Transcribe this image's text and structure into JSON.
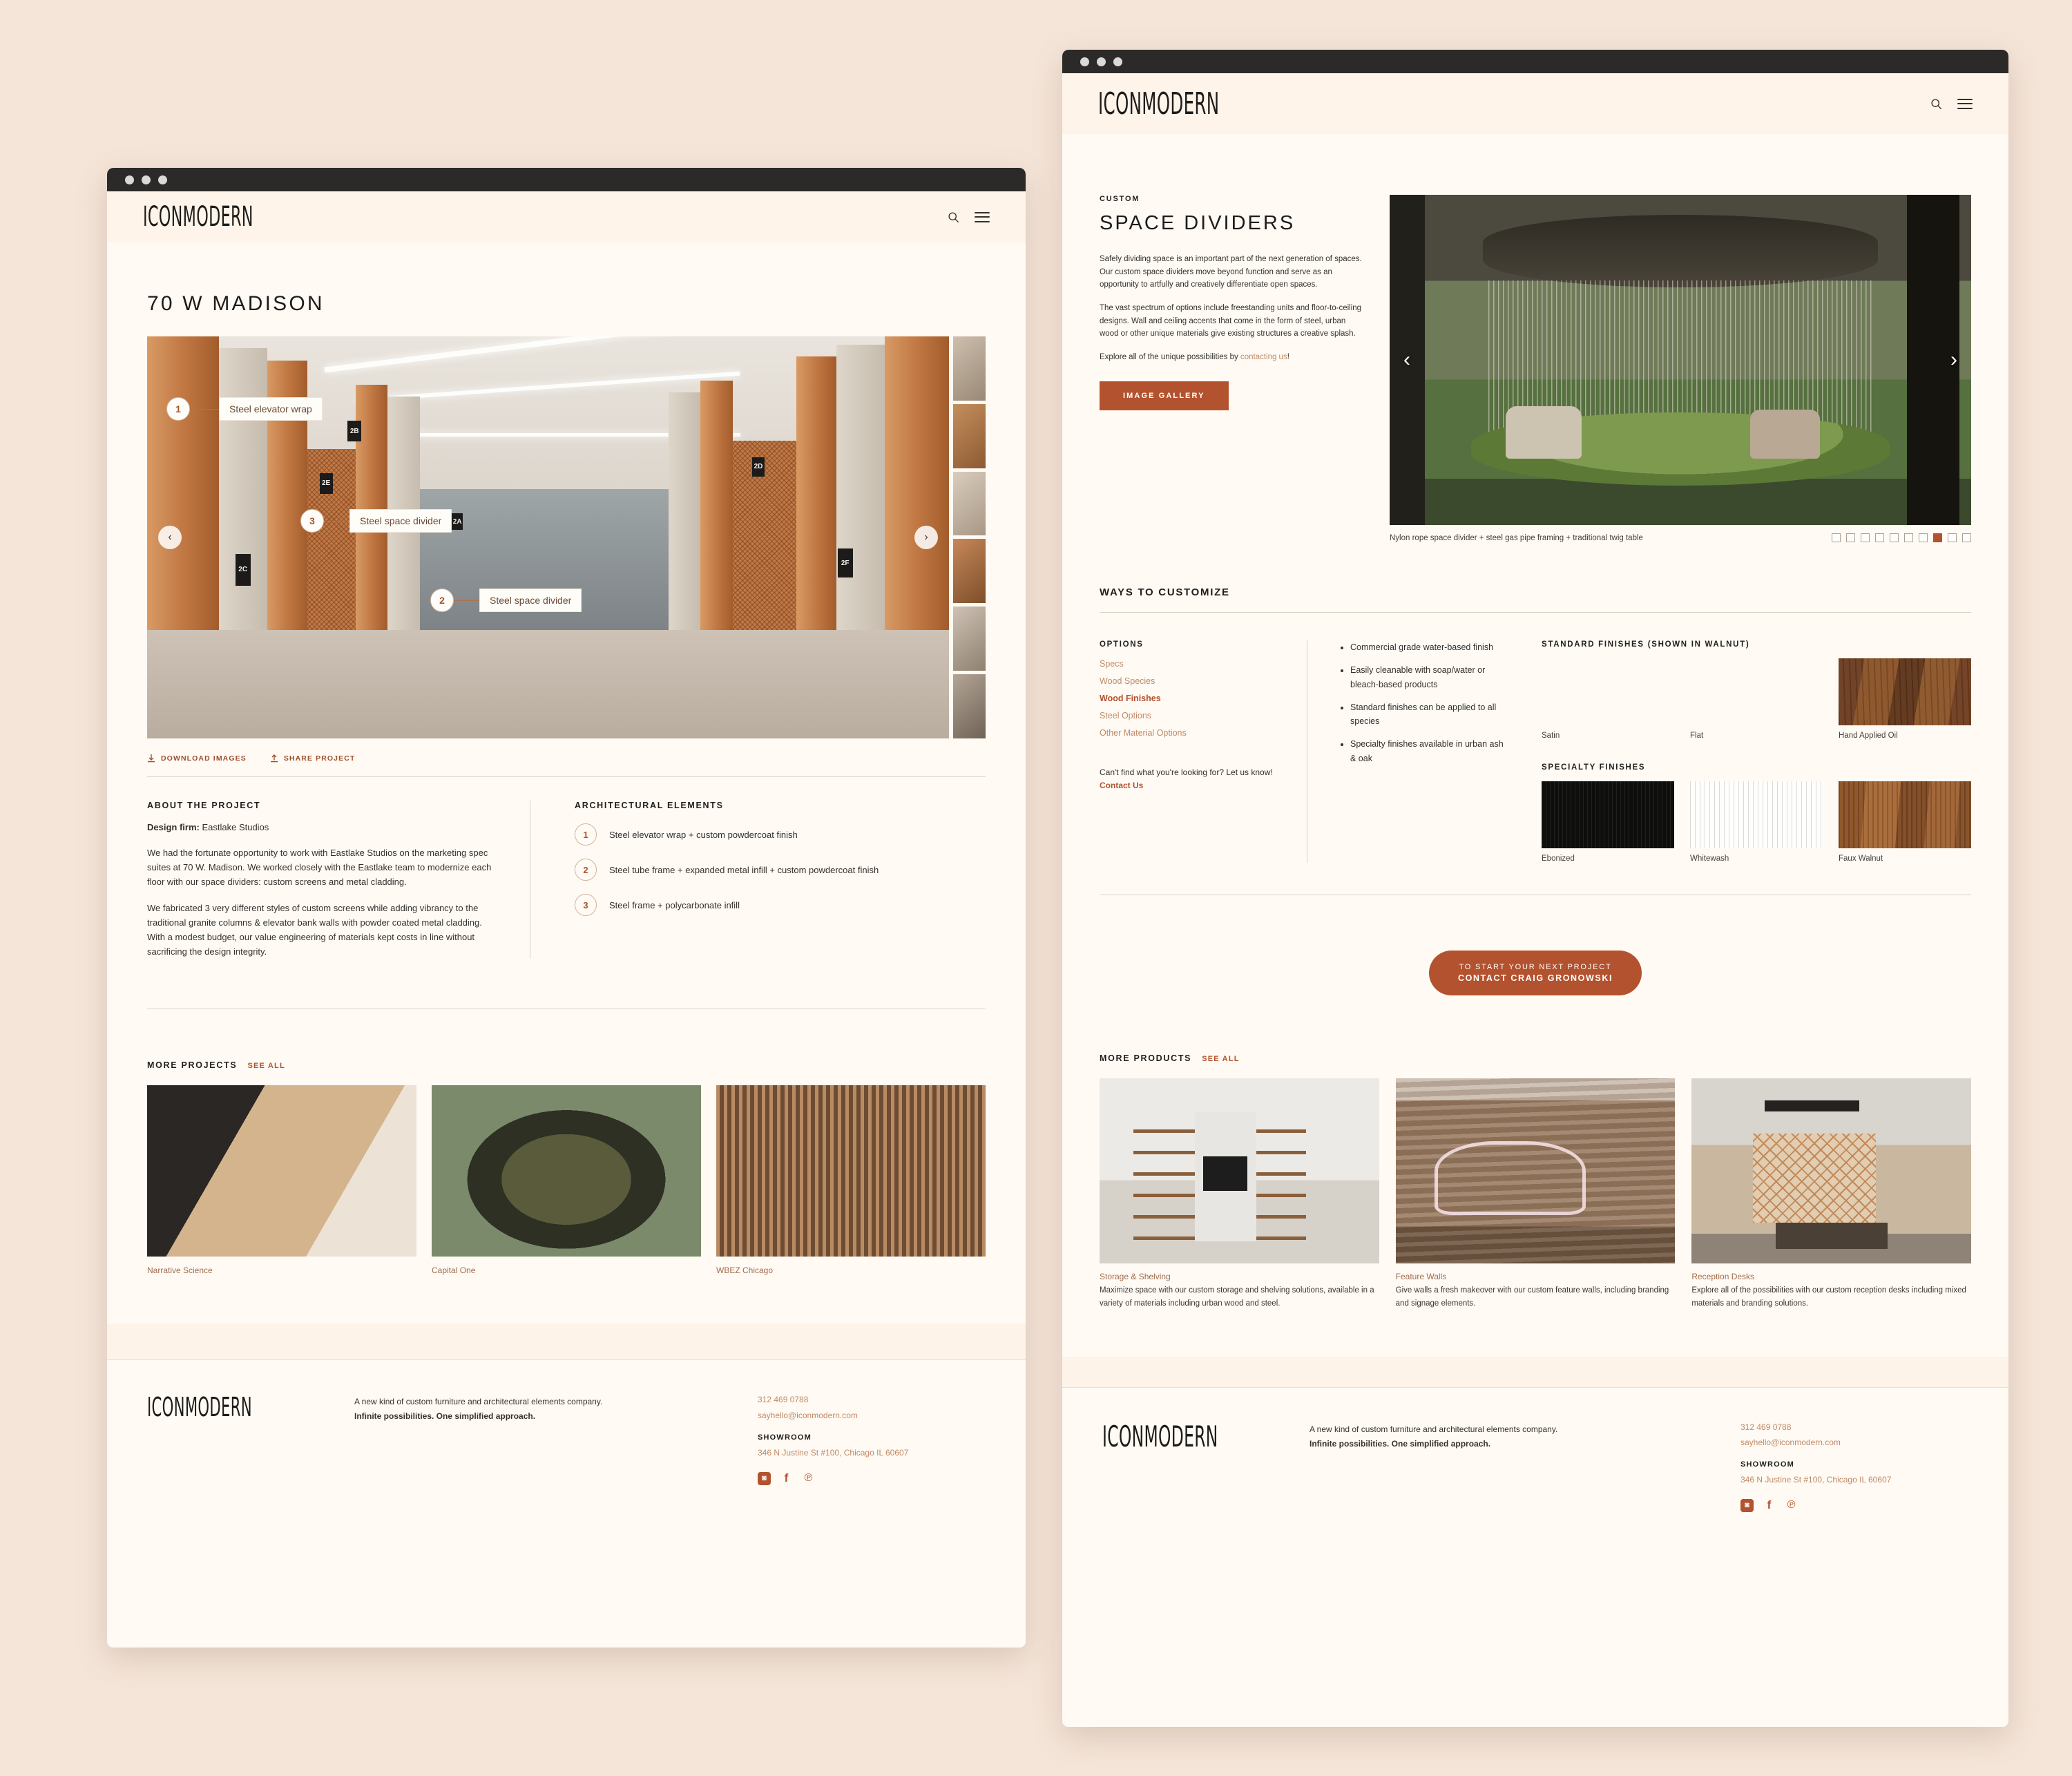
{
  "brand": {
    "logo": "ICONMODERN"
  },
  "header": {
    "search_icon": "search-icon",
    "menu_icon": "hamburger-menu-icon"
  },
  "project_page": {
    "title": "70 W MADISON",
    "hero_callouts": [
      {
        "num": "1",
        "label": "Steel elevator wrap"
      },
      {
        "num": "3",
        "label": "Steel space divider"
      },
      {
        "num": "2",
        "label": "Steel space divider"
      }
    ],
    "hero_prev": "‹",
    "hero_next": "›",
    "meta_links": [
      {
        "label": "DOWNLOAD IMAGES",
        "icon": "download-icon"
      },
      {
        "label": "SHARE PROJECT",
        "icon": "share-icon"
      }
    ],
    "about": {
      "heading": "ABOUT THE PROJECT",
      "design_firm_label": "Design firm:",
      "design_firm": "Eastlake Studios",
      "paragraph1": "We had the fortunate opportunity to work with Eastlake Studios on the marketing spec suites at 70 W. Madison. We worked closely with the Eastlake team to modernize each floor with our space dividers: custom screens and metal cladding.",
      "paragraph2": "We fabricated 3 very different styles of custom screens while adding vibrancy to the traditional granite columns & elevator bank walls with powder coated metal cladding. With a modest budget, our value engineering of materials kept costs in line without sacrificing the design integrity."
    },
    "elements": {
      "heading": "ARCHITECTURAL ELEMENTS",
      "items": [
        {
          "num": "1",
          "text": "Steel elevator wrap + custom powdercoat finish"
        },
        {
          "num": "2",
          "text": "Steel tube frame + expanded metal infill + custom powdercoat finish"
        },
        {
          "num": "3",
          "text": "Steel frame + polycarbonate infill"
        }
      ]
    },
    "more_projects": {
      "heading": "MORE PROJECTS",
      "see_all": "SEE ALL",
      "items": [
        {
          "caption": "Narrative Science"
        },
        {
          "caption": "Capital One"
        },
        {
          "caption": "WBEZ Chicago"
        }
      ]
    }
  },
  "product_page": {
    "eyebrow": "CUSTOM",
    "title": "SPACE DIVIDERS",
    "paragraph1": "Safely dividing space is an important part of the next generation of spaces. Our custom space dividers move beyond function and serve as an opportunity to artfully and creatively differentiate open spaces.",
    "paragraph2": "The vast spectrum of options include freestanding units and floor-to-ceiling designs. Wall and ceiling accents that come in the form of steel, urban wood or other unique materials give existing structures a creative splash.",
    "paragraph3_pre": "Explore all of the unique possibilities by ",
    "paragraph3_link": "contacting us",
    "paragraph3_post": "!",
    "gallery_button": "IMAGE GALLERY",
    "carousel": {
      "prev": "‹",
      "next": "›",
      "caption": "Nylon rope space divider + steel gas pipe framing + traditional twig table",
      "dots_total": 10,
      "dot_active_index": 7
    },
    "customize": {
      "heading": "WAYS TO CUSTOMIZE",
      "options_heading": "OPTIONS",
      "options": [
        {
          "label": "Specs",
          "active": false
        },
        {
          "label": "Wood Species",
          "active": false
        },
        {
          "label": "Wood Finishes",
          "active": true
        },
        {
          "label": "Steel Options",
          "active": false
        },
        {
          "label": "Other Material Options",
          "active": false
        }
      ],
      "help_text": "Can't find what you're looking for? Let us know! ",
      "help_link": "Contact Us",
      "bullets": [
        "Commercial grade water-based finish",
        "Easily cleanable with soap/water or bleach-based products",
        "Standard finishes can be applied to all species",
        "Specialty finishes available in urban ash & oak"
      ],
      "standard_heading": "STANDARD FINISHES (SHOWN IN WALNUT)",
      "standard_swatches": [
        {
          "name": "Satin",
          "swatch": "wood-satin"
        },
        {
          "name": "Flat",
          "swatch": "wood-flat"
        },
        {
          "name": "Hand Applied Oil",
          "swatch": "wood-oil"
        }
      ],
      "specialty_heading": "SPECIALTY FINISHES",
      "specialty_swatches": [
        {
          "name": "Ebonized",
          "swatch": "wood-ebony"
        },
        {
          "name": "Whitewash",
          "swatch": "wood-white"
        },
        {
          "name": "Faux Walnut",
          "swatch": "wood-faux"
        }
      ]
    },
    "cta": {
      "line1": "TO START YOUR NEXT PROJECT",
      "line2": "CONTACT CRAIG GRONOWSKI"
    },
    "more_products": {
      "heading": "MORE PRODUCTS",
      "see_all": "SEE ALL",
      "items": [
        {
          "title": "Storage & Shelving",
          "desc": "Maximize space with our custom storage and shelving solutions, available in a variety of materials including urban wood and steel."
        },
        {
          "title": "Feature Walls",
          "desc": "Give walls a fresh makeover with our custom feature walls, including branding and signage elements."
        },
        {
          "title": "Reception Desks",
          "desc": "Explore all of the possibilities with our custom reception desks including mixed materials and branding solutions."
        }
      ]
    }
  },
  "footer": {
    "logo": "ICONMODERN",
    "desc_line1": "A new kind of custom furniture and architectural elements company.",
    "desc_line2": "Infinite possibilities. One simplified approach.",
    "phone": "312 469 0788",
    "email": "sayhello@iconmodern.com",
    "showroom_label": "SHOWROOM",
    "address": "346 N Justine St #100, Chicago IL 60607",
    "socials": [
      {
        "name": "instagram-icon",
        "glyph": "◙"
      },
      {
        "name": "facebook-icon",
        "glyph": "f"
      },
      {
        "name": "pinterest-icon",
        "glyph": "℗"
      }
    ]
  },
  "colors": {
    "accent": "#b3522e",
    "muted": "#c08a67",
    "page_bg": "#f5e5d8",
    "canvas": "#fffaf4"
  }
}
